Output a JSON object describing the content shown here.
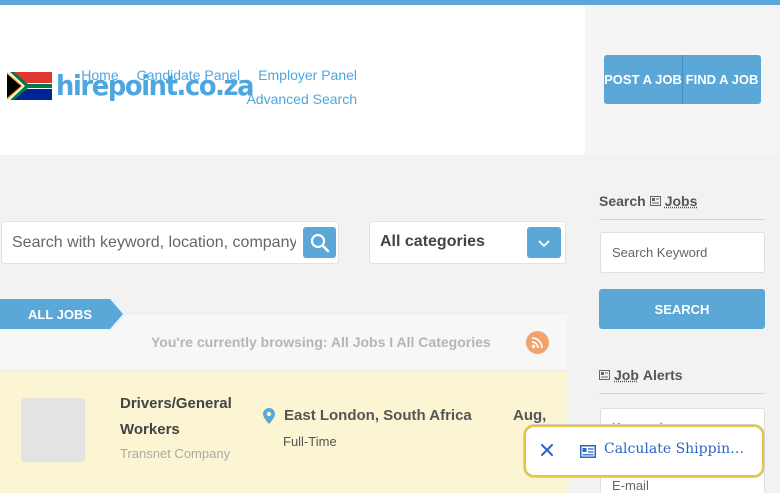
{
  "brand": {
    "logo_text": "hirepoint.co.za"
  },
  "nav": {
    "items": [
      "Home",
      "Candidate Panel",
      "Employer Panel"
    ],
    "advanced": "Advanced Search"
  },
  "actions": {
    "post_job": "POST A JOB",
    "find_job": "FIND A JOB"
  },
  "search": {
    "placeholder": "Search with keyword, location, company",
    "category_selected": "All categories"
  },
  "listing": {
    "tab_label": "ALL JOBS",
    "browsing_text": "You're currently browsing: All Jobs I All Categories"
  },
  "jobs": [
    {
      "title": "Drivers/General Workers",
      "company": "Transnet Company",
      "location": "East London, South Africa",
      "type": "Full-Time",
      "date": "Aug,"
    }
  ],
  "sidebar": {
    "search_title_prefix": "Search",
    "search_title_word": "Jobs",
    "keyword_placeholder": "Search Keyword",
    "search_button": "SEARCH",
    "alerts_title_word": "Job",
    "alerts_title_suffix": "Alerts",
    "alert_keyword_placeholder": "Keyword",
    "alert_email_placeholder": "E-mail"
  },
  "popup": {
    "text": "Calculate Shipping Cost"
  },
  "colors": {
    "accent": "#5aa7d8",
    "highlight_row": "#fbf5d3",
    "popup_border": "#e8c536",
    "rss": "#f0a36a"
  }
}
